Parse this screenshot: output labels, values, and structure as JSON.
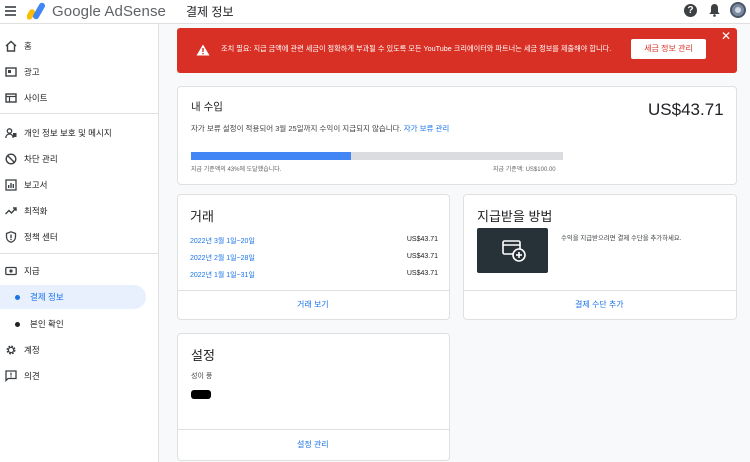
{
  "app": {
    "name": "Google AdSense",
    "page_title": "결제 정보"
  },
  "colors": {
    "accent": "#1a73e8",
    "alert": "#d93025",
    "progress": "#4285f4",
    "active_bg": "#e8f0fe"
  },
  "sidebar": {
    "items": [
      {
        "label": "홈",
        "icon": "home-icon"
      },
      {
        "label": "광고",
        "icon": "ads-icon"
      },
      {
        "label": "사이트",
        "icon": "sites-icon"
      },
      {
        "label": "개인 정보 보호 및 메시지",
        "icon": "privacy-icon"
      },
      {
        "label": "차단 관리",
        "icon": "block-icon"
      },
      {
        "label": "보고서",
        "icon": "reports-icon"
      },
      {
        "label": "최적화",
        "icon": "optimization-icon"
      },
      {
        "label": "정책 센터",
        "icon": "policy-icon"
      },
      {
        "label": "지급",
        "icon": "payments-icon"
      },
      {
        "label": "결제 정보",
        "sub": true,
        "active": true
      },
      {
        "label": "본인 확인",
        "sub": true
      },
      {
        "label": "계정",
        "icon": "gear-icon"
      },
      {
        "label": "의견",
        "icon": "feedback-icon"
      }
    ]
  },
  "alert": {
    "text": "조치 필요: 지급 금액에 관련 세금이 정확하게 부과될 수 있도록 모든 YouTube 크리에이터와 파트너는 세금 정보를 제출해야 합니다.",
    "button": "세금 정보 관리",
    "close": "✕"
  },
  "earnings": {
    "title": "내 수입",
    "amount": "US$43.71",
    "description": "자가 보류 설정이 적용되어 3월 25일까지 수익이 지급되지 않습니다.",
    "hold_link": "자가 보류 관리",
    "progress_percent": 43,
    "progress_label": "지급 기준액의 43%에 도달했습니다.",
    "threshold_label": "지급 기준액: US$100.00"
  },
  "transactions": {
    "title": "거래",
    "rows": [
      {
        "date": "2022년 3월 1일~20일",
        "amount": "US$43.71"
      },
      {
        "date": "2022년 2월 1일~28일",
        "amount": "US$43.71"
      },
      {
        "date": "2022년 1월 1일~31일",
        "amount": "US$43.71"
      }
    ],
    "view_link": "거래 보기"
  },
  "payment_method": {
    "title": "지급받을 방법",
    "description": "수익을 지급받으려면 결제 수단을 추가하세요.",
    "add_link": "결제 수단 추가"
  },
  "settings": {
    "title": "설정",
    "label": "성이 풍",
    "manage_link": "설정 관리"
  }
}
